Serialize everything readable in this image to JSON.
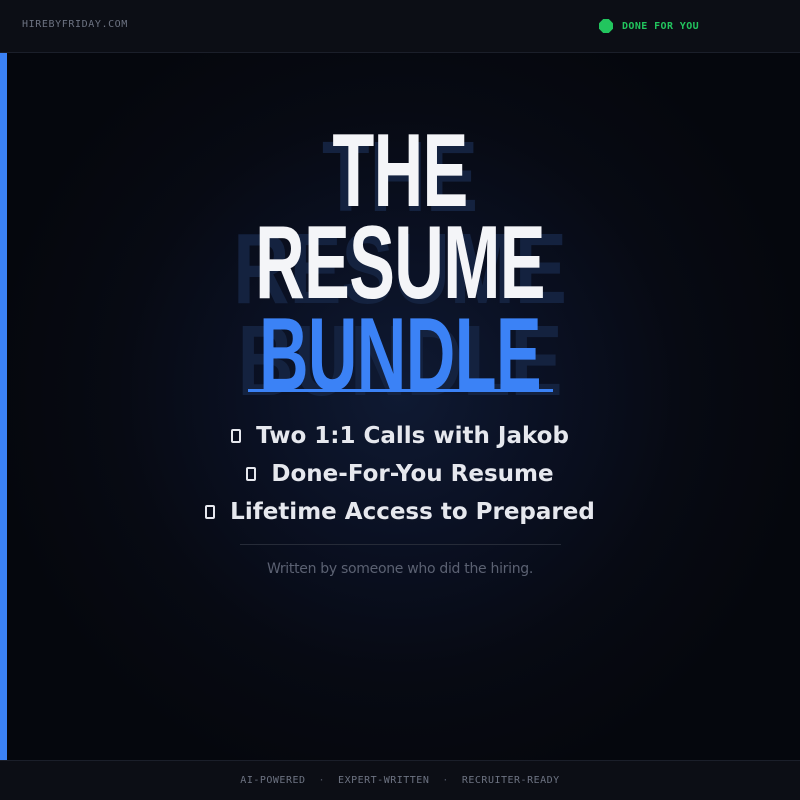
{
  "header": {
    "domain": "HIREBYFRIDAY.COM",
    "status_label": "DONE FOR YOU"
  },
  "hero": {
    "headline": {
      "line1": "THE",
      "line2": "RESUME",
      "line3": "BUNDLE"
    },
    "features": [
      {
        "icon": "checkbox-icon",
        "label": "Two 1:1 Calls with Jakob"
      },
      {
        "icon": "checkbox-icon",
        "label": "Done-For-You Resume"
      },
      {
        "icon": "checkbox-icon",
        "label": "Lifetime Access to Prepared"
      }
    ],
    "tagline": "Written by someone who did the hiring."
  },
  "footer": {
    "items": [
      "AI-POWERED",
      "EXPERT-WRITTEN",
      "RECRUITER-READY"
    ],
    "separator": "·"
  },
  "colors": {
    "background": "#05070d",
    "accent": "#3b82f6",
    "status": "#22c55e",
    "headline": "#f4f5f8"
  }
}
